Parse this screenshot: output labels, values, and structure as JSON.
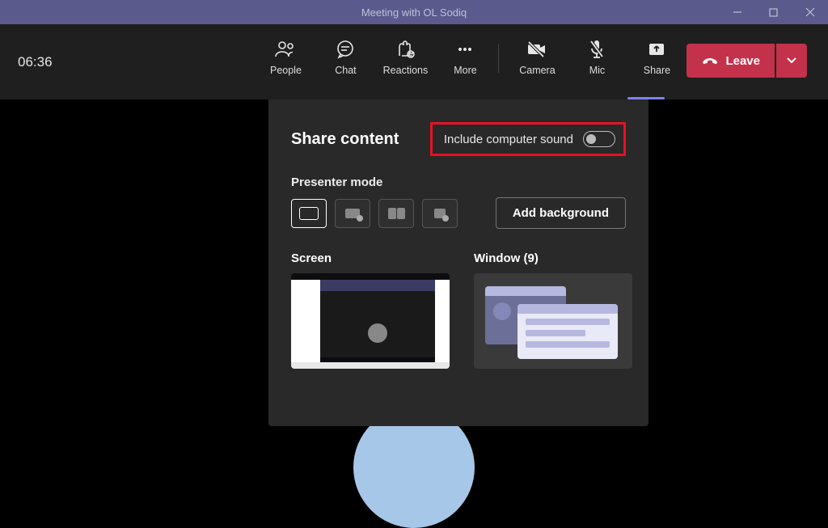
{
  "title": "Meeting with OL Sodiq",
  "duration": "06:36",
  "toolbar": {
    "people": "People",
    "chat": "Chat",
    "reactions": "Reactions",
    "more": "More",
    "camera": "Camera",
    "mic": "Mic",
    "share": "Share",
    "leave": "Leave"
  },
  "share_panel": {
    "title": "Share content",
    "include_sound": "Include computer sound",
    "presenter_mode": "Presenter mode",
    "add_background": "Add background",
    "screen_label": "Screen",
    "window_label": "Window (9)",
    "window_count": 9
  },
  "colors": {
    "accent": "#7b83eb",
    "leave": "#c4314b",
    "highlight": "#e81123",
    "titlebar": "#5a5b8c",
    "panel": "#292929"
  }
}
